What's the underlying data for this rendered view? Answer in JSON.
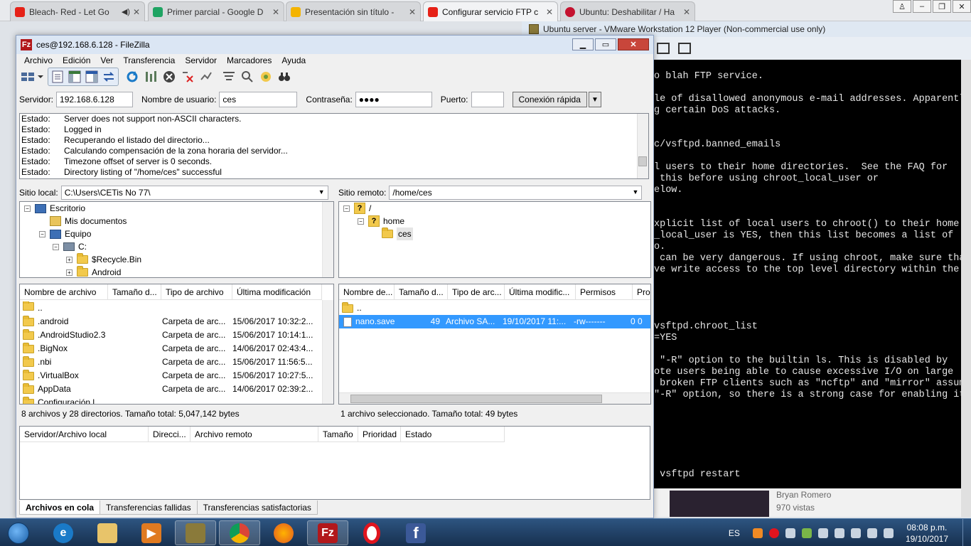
{
  "browser_tabs": [
    {
      "label": "Bleach- Red - Let Go",
      "icon_color": "#e62117",
      "icon": "youtube-icon"
    },
    {
      "label": "Primer parcial - Google D",
      "icon_color": "#1fa463",
      "icon": "drive-icon"
    },
    {
      "label": "Presentación sin título - ",
      "icon_color": "#f4b400",
      "icon": "slides-icon"
    },
    {
      "label": "Configurar servicio FTP c",
      "icon_color": "#e62117",
      "icon": "youtube-icon"
    },
    {
      "label": "Ubuntu: Deshabilitar / Ha",
      "icon_color": "#c4122f",
      "icon": "question-icon"
    }
  ],
  "vmware": {
    "title": "Ubuntu server - VMware Workstation 12 Player (Non-commercial use only)",
    "terminal_lines": [
      "o blah FTP service.",
      "",
      "le of disallowed anonymous e-mail addresses. Apparently",
      "g certain DoS attacks.",
      "",
      "",
      "c/vsftpd.banned_emails",
      "",
      "l users to their home directories.  See the FAQ for",
      " this before using chroot_local_user or",
      "elow.",
      "",
      "",
      "xplicit list of local users to chroot() to their home",
      "_local_user is YES, then this list becomes a list of",
      "o.",
      " can be very dangerous. If using chroot, make sure that",
      "ve write access to the top level directory within the",
      "",
      "",
      "",
      "",
      "vsftpd.chroot_list",
      "=YES",
      "",
      " \"-R\" option to the builtin ls. This is disabled by",
      "ote users being able to cause excessive I/O on large",
      " broken FTP clients such as \"ncftp\" and \"mirror\" assume",
      "\"-R\" option, so there is a strong case for enabling it.",
      "",
      "",
      "",
      "",
      "",
      "",
      " vsftpd restart"
    ],
    "video_author": "Bryan Romero",
    "video_views": "970 vistas"
  },
  "filezilla": {
    "title": "ces@192.168.6.128 - FileZilla",
    "menu": [
      "Archivo",
      "Edición",
      "Ver",
      "Transferencia",
      "Servidor",
      "Marcadores",
      "Ayuda"
    ],
    "quickconnect": {
      "server_label": "Servidor:",
      "server_value": "192.168.6.128",
      "user_label": "Nombre de usuario:",
      "user_value": "ces",
      "password_label": "Contraseña:",
      "password_value": "●●●●",
      "port_label": "Puerto:",
      "port_value": "",
      "connect_label": "Conexión rápida"
    },
    "log": [
      {
        "type": "Estado:",
        "msg": "Server does not support non-ASCII characters."
      },
      {
        "type": "Estado:",
        "msg": "Logged in"
      },
      {
        "type": "Estado:",
        "msg": "Recuperando el listado del directorio..."
      },
      {
        "type": "Estado:",
        "msg": "Calculando compensación de la zona horaria del servidor..."
      },
      {
        "type": "Estado:",
        "msg": "Timezone offset of server is 0 seconds."
      },
      {
        "type": "Estado:",
        "msg": "Directory listing of \"/home/ces\" successful"
      }
    ],
    "local": {
      "site_label": "Sitio local:",
      "path": "C:\\Users\\CETis No 77\\",
      "tree": [
        "Escritorio",
        "Mis documentos",
        "Equipo",
        "C:",
        "$Recycle.Bin",
        "Android"
      ],
      "columns": [
        "Nombre de archivo",
        "Tamaño d...",
        "Tipo de archivo",
        "Última modificación"
      ],
      "files": [
        {
          "name": "..",
          "size": "",
          "type": "",
          "modified": ""
        },
        {
          "name": ".android",
          "size": "",
          "type": "Carpeta de arc...",
          "modified": "15/06/2017 10:32:2..."
        },
        {
          "name": ".AndroidStudio2.3",
          "size": "",
          "type": "Carpeta de arc...",
          "modified": "15/06/2017 10:14:1..."
        },
        {
          "name": ".BigNox",
          "size": "",
          "type": "Carpeta de arc...",
          "modified": "14/06/2017 02:43:4..."
        },
        {
          "name": ".nbi",
          "size": "",
          "type": "Carpeta de arc...",
          "modified": "15/06/2017 11:56:5..."
        },
        {
          "name": ".VirtualBox",
          "size": "",
          "type": "Carpeta de arc...",
          "modified": "15/06/2017 10:27:5..."
        },
        {
          "name": "AppData",
          "size": "",
          "type": "Carpeta de arc...",
          "modified": "14/06/2017 02:39:2..."
        },
        {
          "name": "Configuración l...",
          "size": "",
          "type": "",
          "modified": ""
        }
      ],
      "status": "8 archivos y 28 directorios. Tamaño total: 5,047,142 bytes"
    },
    "remote": {
      "site_label": "Sitio remoto:",
      "path": "/home/ces",
      "tree": [
        "/",
        "home",
        "ces"
      ],
      "columns": [
        "Nombre de...",
        "Tamaño d...",
        "Tipo de arc...",
        "Última modific...",
        "Permisos",
        "Pro"
      ],
      "files": [
        {
          "name": "..",
          "size": "",
          "type": "",
          "modified": "",
          "perms": "",
          "owner": ""
        },
        {
          "name": "nano.save",
          "size": "49",
          "type": "Archivo SA...",
          "modified": "19/10/2017 11:...",
          "perms": "-rw-------",
          "owner": "0 0"
        }
      ],
      "status": "1 archivo seleccionado. Tamaño total: 49 bytes"
    },
    "queue_columns": [
      "Servidor/Archivo local",
      "Direcci...",
      "Archivo remoto",
      "Tamaño",
      "Prioridad",
      "Estado"
    ],
    "queue_tabs": [
      "Archivos en cola",
      "Transferencias fallidas",
      "Transferencias satisfactorias"
    ]
  },
  "taskbar": {
    "language": "ES",
    "time": "08:08 p.m.",
    "date": "19/10/2017"
  }
}
